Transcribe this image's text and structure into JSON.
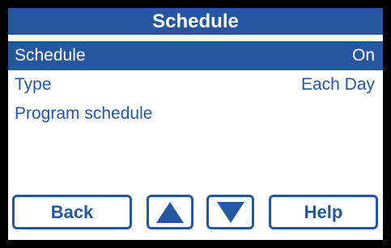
{
  "header": {
    "title": "Schedule"
  },
  "menu": {
    "items": [
      {
        "label": "Schedule",
        "value": "On"
      },
      {
        "label": "Type",
        "value": "Each Day"
      },
      {
        "label": "Program schedule",
        "value": ""
      }
    ],
    "selected_index": 0
  },
  "footer": {
    "back_label": "Back",
    "help_label": "Help",
    "up_icon": "up-arrow-icon",
    "down_icon": "down-arrow-icon"
  },
  "colors": {
    "accent": "#2457a0",
    "background": "#ffffff",
    "bezel": "#000000"
  }
}
